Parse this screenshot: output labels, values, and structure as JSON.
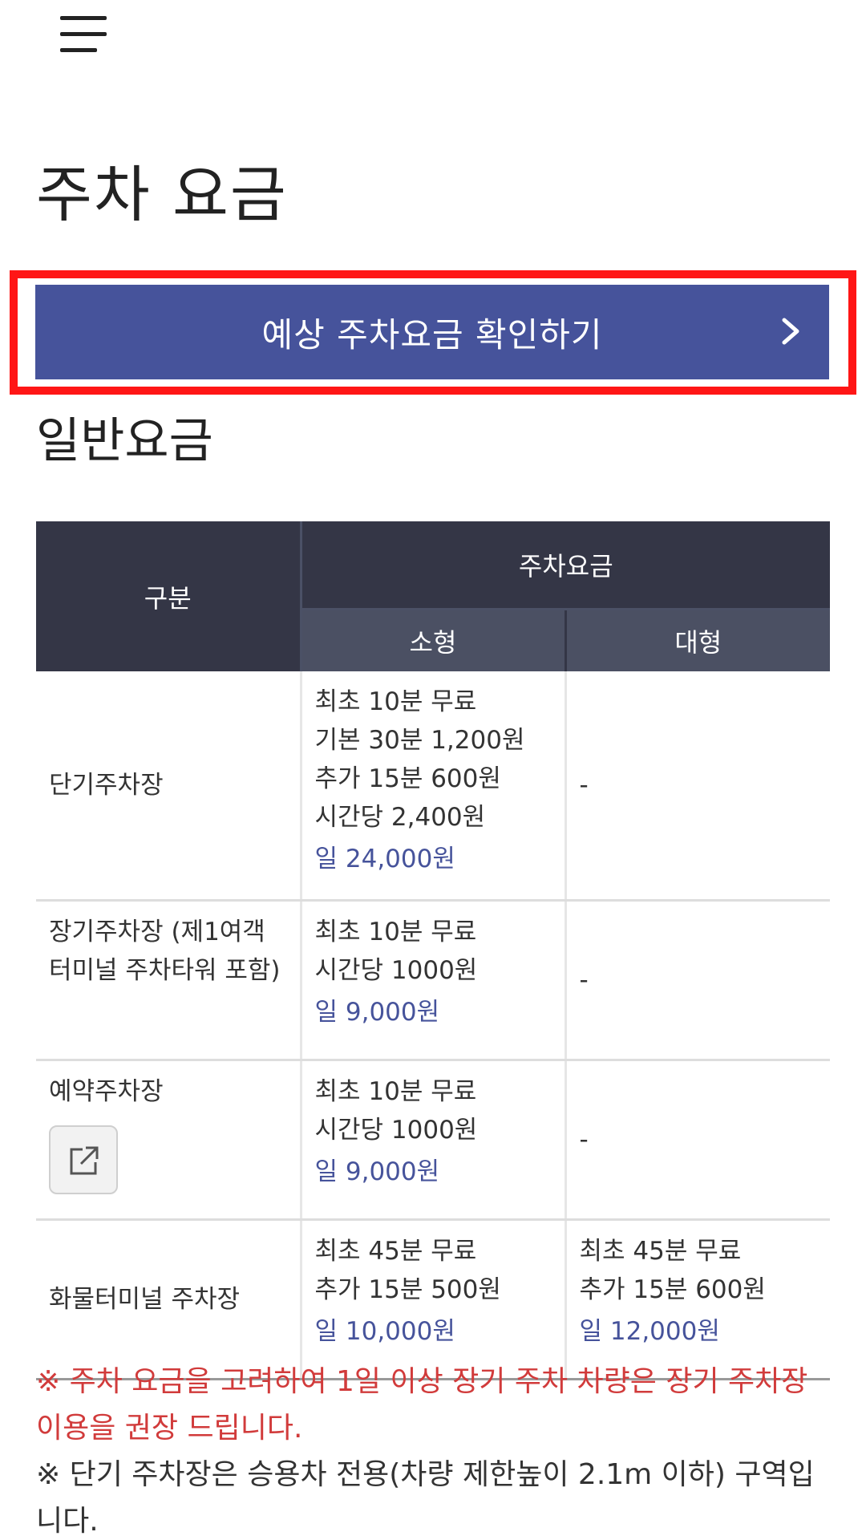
{
  "page_title": "주차 요금",
  "cta": {
    "label": "예상 주차요금 확인하기"
  },
  "section_title": "일반요금",
  "table": {
    "header_category": "구분",
    "header_group": "주차요금",
    "header_small": "소형",
    "header_large": "대형",
    "rows": [
      {
        "category": "단기주차장",
        "small": [
          "최초 10분 무료",
          "기본 30분 1,200원",
          "추가 15분 600원",
          "시간당 2,400원"
        ],
        "small_day": "일 24,000원",
        "large": "-"
      },
      {
        "category": "장기주차장 (제1여객 터미널 주차타워 포함)",
        "small": [
          "최초 10분 무료",
          "시간당 1000원"
        ],
        "small_day": "일 9,000원",
        "large": "-"
      },
      {
        "category": "예약주차장",
        "small": [
          "최초 10분 무료",
          "시간당 1000원"
        ],
        "small_day": "일 9,000원",
        "large": "-"
      },
      {
        "category": "화물터미널 주차장",
        "small": [
          "최초 45분 무료",
          "추가 15분 500원"
        ],
        "small_day": "일 10,000원",
        "large_lines": [
          "최초 45분 무료",
          "추가 15분 600원"
        ],
        "large_day": "일 12,000원"
      }
    ]
  },
  "notes": {
    "red": "※ 주차 요금을 고려하여 1일 이상 장기 주차 차량은 장기 주차장 이용을 권장 드립니다.",
    "gray": "※ 단기 주차장은 승용차 전용(차량 제한높이 2.1m 이하) 구역입니다."
  },
  "colors": {
    "accent": "#46539b",
    "highlight_border": "#ff1616",
    "header_dark": "#343646",
    "header_sub": "#4b5063",
    "note_red": "#d13b3b"
  },
  "icons": [
    "menu-icon",
    "chevron-right-icon",
    "external-link-icon"
  ]
}
